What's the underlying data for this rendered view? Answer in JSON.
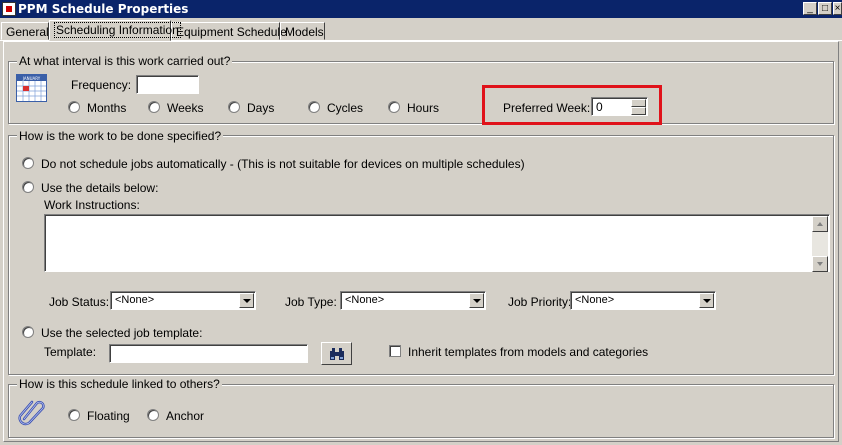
{
  "window": {
    "title": "PPM Schedule Properties",
    "controls": {
      "minimize": "_",
      "maximize": "□",
      "close": "×"
    }
  },
  "tabs": [
    {
      "label": "General",
      "active": false
    },
    {
      "label": "Scheduling Information",
      "active": true
    },
    {
      "label": "Equipment Schedule",
      "active": false
    },
    {
      "label": "Models",
      "active": false
    }
  ],
  "interval": {
    "legend": "At what interval is this work carried out?",
    "calendar_icon_text": "JANUARY",
    "frequency_label": "Frequency:",
    "frequency_value": "",
    "units": [
      "Months",
      "Weeks",
      "Days",
      "Cycles",
      "Hours"
    ],
    "preferred_week_label": "Preferred Week:",
    "preferred_week_value": "0"
  },
  "work": {
    "legend": "How is the work to be done specified?",
    "option_no_auto": "Do not schedule jobs automatically - (This is not suitable for devices on multiple schedules)",
    "option_details": "Use the details below:",
    "instructions_label": "Work Instructions:",
    "instructions_value": "",
    "job_status_label": "Job Status:",
    "job_status_value": "<None>",
    "job_type_label": "Job Type:",
    "job_type_value": "<None>",
    "job_priority_label": "Job Priority:",
    "job_priority_value": "<None>",
    "option_template": "Use the selected job template:",
    "template_label": "Template:",
    "template_value": "",
    "inherit_label": "Inherit templates from models and categories"
  },
  "linking": {
    "legend": "How is this schedule linked to others?",
    "floating_label": "Floating",
    "anchor_label": "Anchor"
  },
  "colors": {
    "titlebar": "#0a246a",
    "highlight": "#e0121a",
    "dialog": "#d4d0c8"
  },
  "icons": [
    "calendar-icon",
    "binoculars-icon",
    "paperclip-icon"
  ]
}
